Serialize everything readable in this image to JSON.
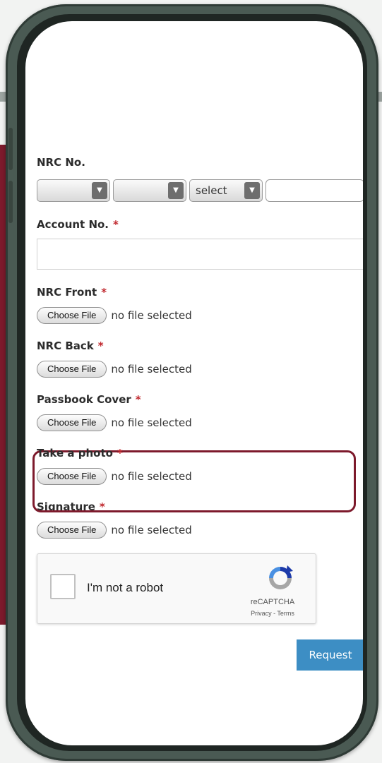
{
  "form": {
    "nrc_label": "NRC No.",
    "nrc_select_1": "",
    "nrc_select_2": "",
    "nrc_select_3": "select",
    "nrc_number_value": "",
    "account_label": "Account No.",
    "account_value": "",
    "required_mark": "*",
    "file_button_label": "Choose File",
    "file_status": "no file selected",
    "fields": [
      {
        "label": "NRC Front"
      },
      {
        "label": "NRC Back"
      },
      {
        "label": "Passbook Cover"
      },
      {
        "label": "Take a photo"
      },
      {
        "label": "Signature"
      }
    ],
    "captcha": {
      "label": "I'm not a robot",
      "brand": "reCAPTCHA",
      "links": "Privacy - Terms"
    },
    "submit_label": "Request"
  },
  "colors": {
    "accent_crimson": "#7d1a2c",
    "required": "#c0272d",
    "button_blue": "#3d8ec4"
  }
}
